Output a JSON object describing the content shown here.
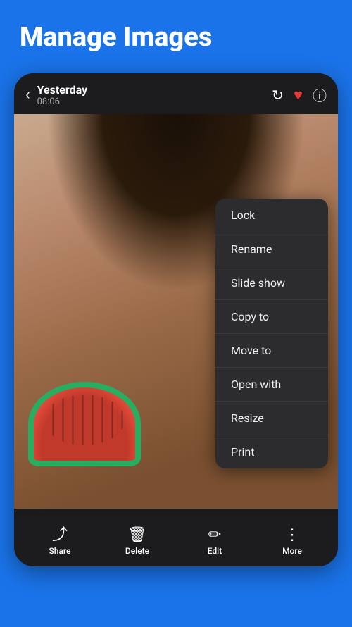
{
  "header": {
    "top_title": "Manage Images",
    "photo_date": "Yesterday",
    "photo_time": "08:06",
    "back_icon": "‹",
    "refresh_icon": "↻",
    "heart_icon": "♥",
    "info_icon": "ⓘ"
  },
  "context_menu": {
    "items": [
      {
        "id": "lock",
        "label": "Lock"
      },
      {
        "id": "rename",
        "label": "Rename"
      },
      {
        "id": "slide-show",
        "label": "Slide show"
      },
      {
        "id": "copy-to",
        "label": "Copy to"
      },
      {
        "id": "move-to",
        "label": "Move to"
      },
      {
        "id": "open-with",
        "label": "Open with"
      },
      {
        "id": "resize",
        "label": "Resize"
      },
      {
        "id": "print",
        "label": "Print"
      }
    ]
  },
  "bottom_nav": {
    "items": [
      {
        "id": "share",
        "label": "Share",
        "icon": "⤴"
      },
      {
        "id": "delete",
        "label": "Delete",
        "icon": "🗑"
      },
      {
        "id": "edit",
        "label": "Edit",
        "icon": "✏"
      },
      {
        "id": "more",
        "label": "More",
        "icon": "⋮"
      }
    ]
  }
}
